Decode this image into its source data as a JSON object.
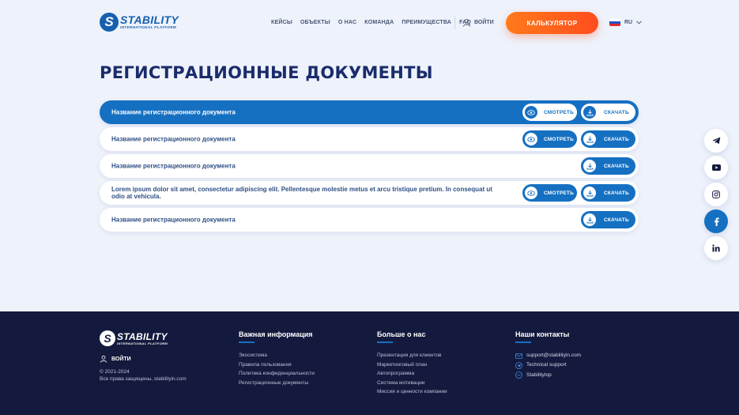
{
  "header": {
    "logo_word": "STABILITY",
    "logo_sub": "INTERNATIONAL PLATFORM",
    "nav": [
      "КЕЙСЫ",
      "ОБЪЕКТЫ",
      "О НАС",
      "КОМАНДА",
      "ПРЕИМУЩЕСТВА",
      "FAQ"
    ],
    "login": "ВОЙТИ",
    "calc": "КАЛЬКУЛЯТОР",
    "lang": "RU"
  },
  "page_title": "РЕГИСТРАЦИОННЫЕ ДОКУМЕНТЫ",
  "documents": [
    {
      "name": "Название регистрационного документа",
      "view": "СМОТРЕТЬ",
      "download": "СКАЧАТЬ"
    },
    {
      "name": "Название регистрационного документа",
      "view": "СМОТРЕТЬ",
      "download": "СКАЧАТЬ"
    },
    {
      "name": "Название регистрационного документа",
      "download": "СКАЧАТЬ"
    },
    {
      "name": "Lorem ipsum dolor sit amet, consectetur adipiscing elit. Pellentesque molestie metus et arcu tristique pretium. In consequat ut odio at vehicula.",
      "view": "СМОТРЕТЬ",
      "download": "СКАЧАТЬ"
    },
    {
      "name": "Название регистрационного документа",
      "download": "СКАЧАТЬ"
    }
  ],
  "social": [
    "telegram-icon",
    "youtube-icon",
    "instagram-icon",
    "facebook-icon",
    "linkedin-icon"
  ],
  "footer": {
    "logo_word": "STABILITY",
    "logo_sub": "INTERNATIONAL PLATFORM",
    "login": "ВОЙТИ",
    "copyright_1": "© 2021-2024",
    "copyright_2": "Все права защищены, stabilityin.com",
    "col1": {
      "title": "Важная информация",
      "links": [
        "Экосистема",
        "Правила пользования",
        "Политика конфиденциальности",
        "Регистрационные документы"
      ]
    },
    "col2": {
      "title": "Больше о нас",
      "links": [
        "Презентация для клиентов",
        "Маркетинговый план",
        "Автопрограмма",
        "Система мотивации",
        "Миссия и ценности компании"
      ]
    },
    "col3": {
      "title": "Наши контакты",
      "contacts": [
        "support@stabilityin.com",
        "Technical support",
        "Stabilitytop"
      ]
    }
  },
  "colors": {
    "accent": "#1570c2",
    "cta": "#ff5a1f",
    "footer_bg": "#141a3d",
    "page_bg": "#eef2fb"
  }
}
